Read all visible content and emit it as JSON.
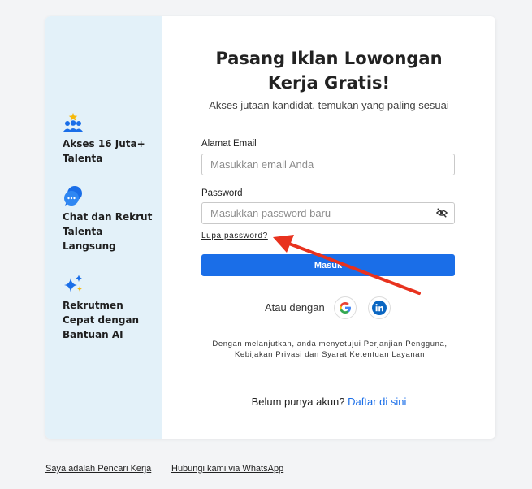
{
  "sidebar": {
    "features": [
      {
        "icon": "people-star-icon",
        "label": "Akses 16 Juta+ Talenta"
      },
      {
        "icon": "chat-bubble-icon",
        "label": "Chat dan Rekrut Talenta Langsung"
      },
      {
        "icon": "sparkle-icon",
        "label": "Rekrutmen Cepat dengan Bantuan AI"
      }
    ]
  },
  "form": {
    "title": "Pasang Iklan Lowongan Kerja Gratis!",
    "subtitle": "Akses jutaan kandidat, temukan yang paling sesuai",
    "email_label": "Alamat Email",
    "email_placeholder": "Masukkan email Anda",
    "password_label": "Password",
    "password_placeholder": "Masukkan password baru",
    "forgot_password": "Lupa password?",
    "login_button": "Masuk",
    "or_with": "Atau dengan",
    "terms": "Dengan melanjutkan, anda menyetujui Perjanjian Pengguna, Kebijakan Privasi dan Syarat Ketentuan Layanan",
    "signup_prompt": "Belum punya akun?",
    "signup_link": "Daftar di sini"
  },
  "footer": {
    "job_seeker_link": "Saya adalah Pencari Kerja",
    "whatsapp_link": "Hubungi kami via WhatsApp"
  },
  "colors": {
    "accent": "#1a6ee8",
    "sidebar_bg": "#e3f1f9",
    "annotation_arrow": "#e8321e"
  }
}
